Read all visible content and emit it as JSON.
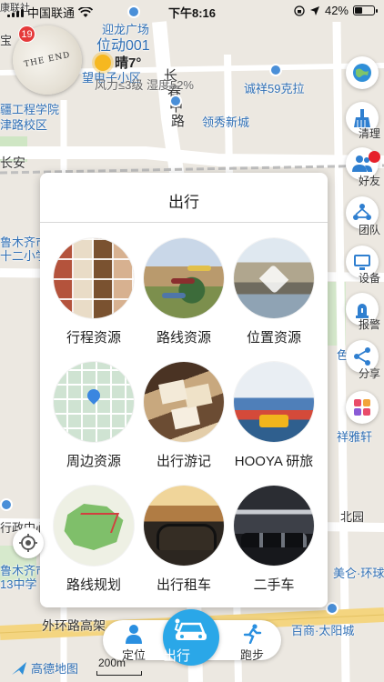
{
  "status_bar": {
    "carrier": "中国联通",
    "time": "下午8:16",
    "battery": "42%",
    "battery_level": 0.42
  },
  "profile": {
    "avatar_text": "THE END",
    "notification_count": "19"
  },
  "location": {
    "name": "位动001",
    "weather": "晴7°",
    "wind": "风力≤3级 湿度52%"
  },
  "map_labels": {
    "guanghe": "迎龙广场",
    "xiaoqu": "望电子小区",
    "road1": "长",
    "road2": "春",
    "road3": "中",
    "road4": "路",
    "chengxiang": "诚祥59克拉",
    "college1": "疆工程学院",
    "college2": "津路校区",
    "lingxiu": "领秀新城",
    "changan": "长安",
    "school1": "鲁木齐市",
    "school2": "十二小学",
    "color": "色幕",
    "xiangya": "祥雅轩",
    "xingzheng": "行政中心",
    "school3": "鲁木齐市",
    "school4": "13中学",
    "meilun": "美仑·环球",
    "beiyuan": "北园",
    "ring_road": "外环路高架",
    "baishang": "百商·太阳城",
    "top_left": "宝",
    "shuchang": "康联社"
  },
  "tools": [
    {
      "label": "清理",
      "icon": "broom-icon"
    },
    {
      "label": "好友",
      "icon": "friends-icon"
    },
    {
      "label": "团队",
      "icon": "team-icon"
    },
    {
      "label": "设备",
      "icon": "device-icon"
    },
    {
      "label": "报警",
      "icon": "alarm-icon"
    },
    {
      "label": "分享",
      "icon": "share-icon"
    },
    {
      "label": "",
      "icon": "apps-icon"
    }
  ],
  "modal": {
    "title": "出行",
    "items": [
      {
        "label": "行程资源"
      },
      {
        "label": "路线资源"
      },
      {
        "label": "位置资源"
      },
      {
        "label": "周边资源"
      },
      {
        "label": "出行游记"
      },
      {
        "label": "HOOYA 研旅"
      },
      {
        "label": "路线规划"
      },
      {
        "label": "出行租车"
      },
      {
        "label": "二手车"
      }
    ]
  },
  "bottom_nav": {
    "left": "定位",
    "center": "出行",
    "right": "跑步"
  },
  "footer": {
    "logo": "高德地图",
    "scale": "200m"
  }
}
